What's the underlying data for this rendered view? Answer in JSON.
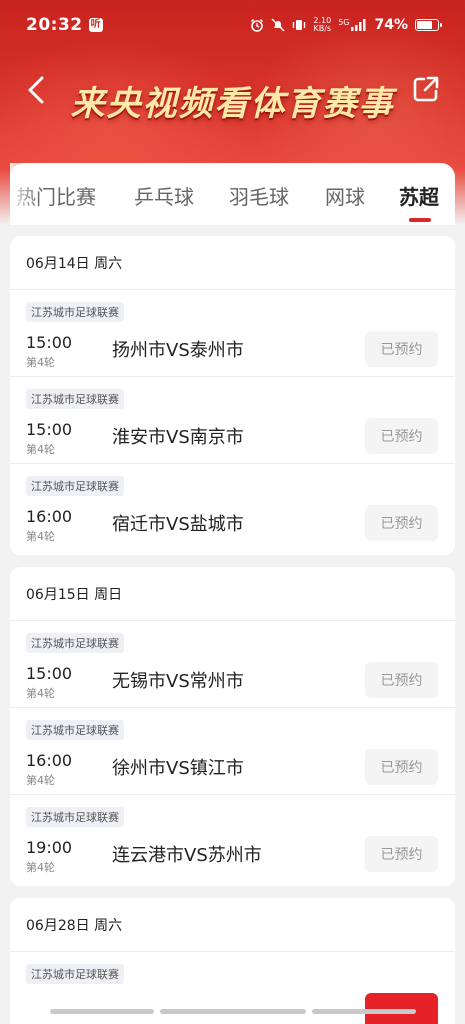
{
  "status_bar": {
    "time": "20:32",
    "app_badge": "听",
    "network_speed_value": "2.10",
    "network_speed_unit": "KB/s",
    "network_type": "5G",
    "battery_percent": "74%",
    "battery_level": 0.74
  },
  "header": {
    "title": "来央视频看体育赛事",
    "back_icon": "back-arrow-icon",
    "share_icon": "share-icon"
  },
  "tabs": [
    {
      "label": "热门比赛",
      "active": false
    },
    {
      "label": "乒乓球",
      "active": false
    },
    {
      "label": "羽毛球",
      "active": false
    },
    {
      "label": "网球",
      "active": false
    },
    {
      "label": "苏超",
      "active": true
    }
  ],
  "days": [
    {
      "date": "06月14日 周六",
      "matches": [
        {
          "league": "江苏城市足球联赛",
          "time": "15:00",
          "round": "第4轮",
          "teams": "扬州市VS泰州市",
          "button": "已预约"
        },
        {
          "league": "江苏城市足球联赛",
          "time": "15:00",
          "round": "第4轮",
          "teams": "淮安市VS南京市",
          "button": "已预约"
        },
        {
          "league": "江苏城市足球联赛",
          "time": "16:00",
          "round": "第4轮",
          "teams": "宿迁市VS盐城市",
          "button": "已预约"
        }
      ]
    },
    {
      "date": "06月15日 周日",
      "matches": [
        {
          "league": "江苏城市足球联赛",
          "time": "15:00",
          "round": "第4轮",
          "teams": "无锡市VS常州市",
          "button": "已预约"
        },
        {
          "league": "江苏城市足球联赛",
          "time": "16:00",
          "round": "第4轮",
          "teams": "徐州市VS镇江市",
          "button": "已预约"
        },
        {
          "league": "江苏城市足球联赛",
          "time": "19:00",
          "round": "第4轮",
          "teams": "连云港市VS苏州市",
          "button": "已预约"
        }
      ]
    },
    {
      "date": "06月28日 周六",
      "matches": [
        {
          "league": "江苏城市足球联赛"
        }
      ]
    }
  ],
  "colors": {
    "brand_red": "#d8282b",
    "title_gold": "#ffe9a8",
    "booked_bg": "#f4f4f4",
    "booked_text": "#999999"
  }
}
